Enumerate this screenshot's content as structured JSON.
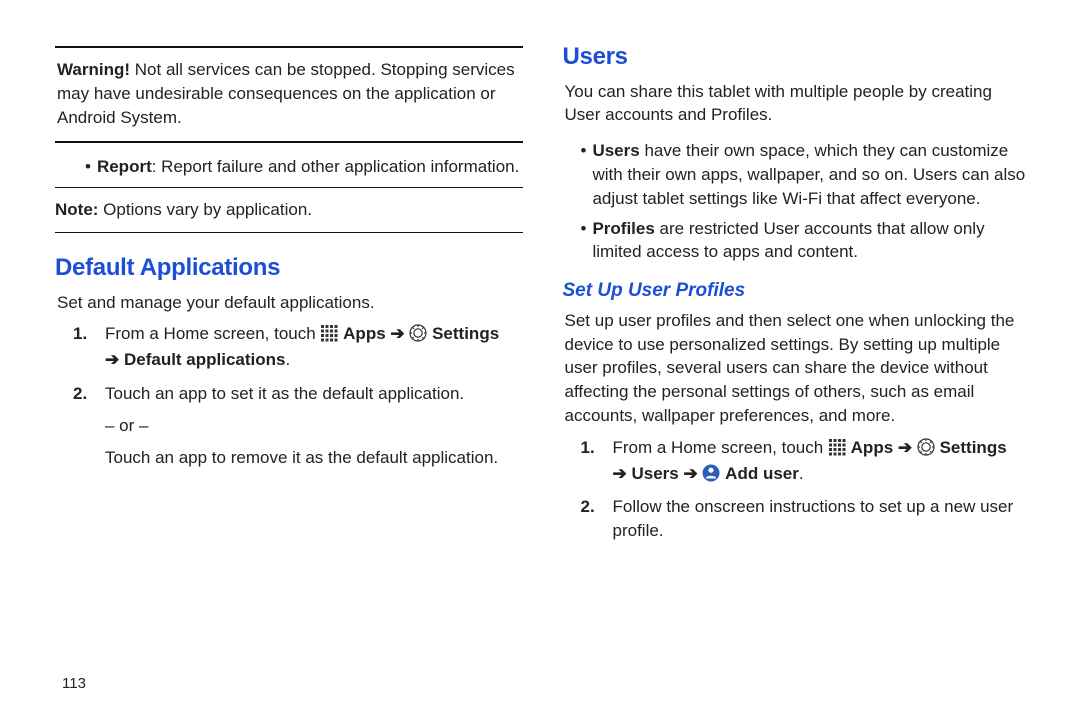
{
  "left": {
    "warning": {
      "label": "Warning!",
      "text": "Not all services can be stopped. Stopping services may have undesirable consequences on the application or Android System."
    },
    "report": {
      "label": "Report",
      "text": ": Report failure and other application information."
    },
    "note": {
      "label": "Note:",
      "text": " Options vary by application."
    },
    "section_title": "Default Applications",
    "section_intro": "Set and manage your default applications.",
    "step1": {
      "num": "1.",
      "prefix": "From a Home screen, touch ",
      "apps": "Apps",
      "arrow1": " ➔ ",
      "settings": "Settings",
      "arrow2": "➔ ",
      "default_apps": "Default applications",
      "period": "."
    },
    "step2": {
      "num": "2.",
      "line1": "Touch an app to set it as the default application.",
      "or": "– or –",
      "line2": "Touch an app to remove it as the default application."
    }
  },
  "right": {
    "section_title": "Users",
    "intro": "You can share this tablet with multiple people by creating User accounts and Profiles.",
    "bullet1": {
      "label": "Users",
      "text": " have their own space, which they can customize with their own apps, wallpaper, and so on. Users can also adjust tablet settings like Wi-Fi that affect everyone."
    },
    "bullet2": {
      "label": "Profiles",
      "text": " are restricted User accounts that allow only limited access to apps and content."
    },
    "subsection_title": "Set Up User Profiles",
    "sub_intro": "Set up user profiles and then select one when unlocking the device to use personalized settings. By setting up multiple user profiles, several users can share the device without affecting the personal settings of others, such as email accounts, wallpaper preferences, and more.",
    "step1": {
      "num": "1.",
      "prefix": "From a Home screen, touch ",
      "apps": "Apps",
      "arrow1": " ➔ ",
      "settings": "Settings",
      "arrow2": "➔ ",
      "users": "Users",
      "arrow3": " ➔ ",
      "adduser": "Add user",
      "period": "."
    },
    "step2": {
      "num": "2.",
      "text": "Follow the onscreen instructions to set up a new user profile."
    }
  },
  "page_number": "113"
}
